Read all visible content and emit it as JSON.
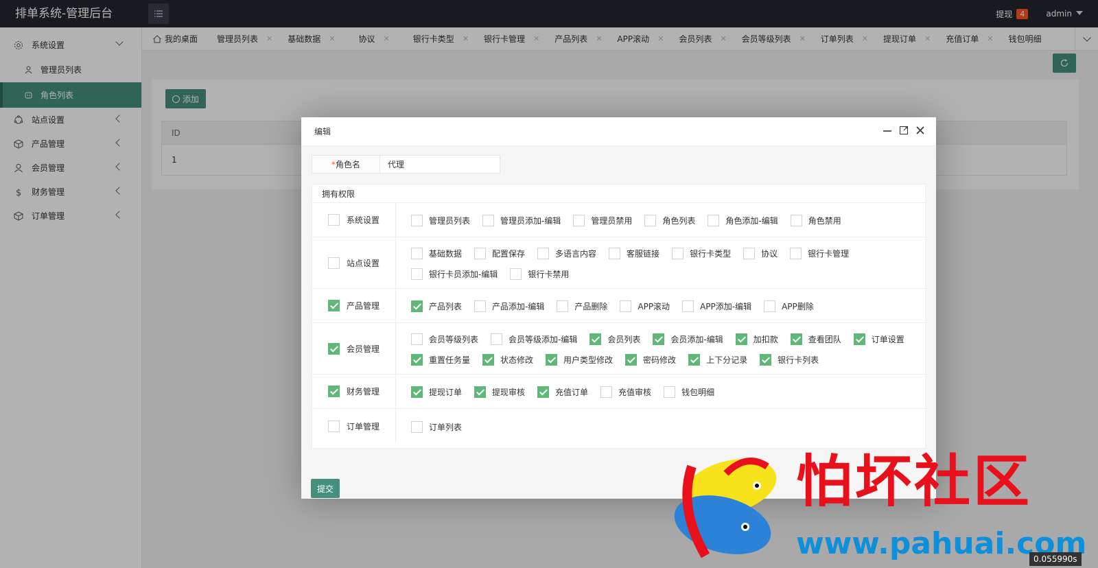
{
  "header": {
    "title": "排单系统-管理后台",
    "withdraw_label": "提现",
    "withdraw_count": "4",
    "user": "admin"
  },
  "sidebar": {
    "items": [
      {
        "label": "系统设置",
        "icon": "gear-icon",
        "expanded": true
      },
      {
        "label": "管理员列表",
        "icon": "user-icon",
        "sub": true
      },
      {
        "label": "角色列表",
        "icon": "role-icon",
        "sub": true,
        "active": true
      },
      {
        "label": "站点设置",
        "icon": "site-icon"
      },
      {
        "label": "产品管理",
        "icon": "box-icon"
      },
      {
        "label": "会员管理",
        "icon": "member-icon"
      },
      {
        "label": "财务管理",
        "icon": "dollar-icon"
      },
      {
        "label": "订单管理",
        "icon": "order-icon"
      }
    ]
  },
  "tabs": [
    "我的桌面",
    "管理员列表",
    "基础数据",
    "协议",
    "银行卡类型",
    "银行卡管理",
    "产品列表",
    "APP滚动",
    "会员列表",
    "会员等级列表",
    "订单列表",
    "提现订单",
    "充值订单",
    "钱包明细"
  ],
  "background": {
    "add_label": "添加",
    "table_header": "ID",
    "table_row": "1"
  },
  "modal": {
    "title": "编辑",
    "role_name_label": "角色名",
    "role_name_value": "代理",
    "permissions_title": "拥有权限",
    "submit_label": "提交",
    "groups": [
      {
        "name": "系统设置",
        "checked": false,
        "perms": [
          {
            "label": "管理员列表",
            "checked": false
          },
          {
            "label": "管理员添加-编辑",
            "checked": false
          },
          {
            "label": "管理员禁用",
            "checked": false
          },
          {
            "label": "角色列表",
            "checked": false
          },
          {
            "label": "角色添加-编辑",
            "checked": false
          },
          {
            "label": "角色禁用",
            "checked": false
          }
        ]
      },
      {
        "name": "站点设置",
        "checked": false,
        "perms": [
          {
            "label": "基础数据",
            "checked": false
          },
          {
            "label": "配置保存",
            "checked": false
          },
          {
            "label": "多语言内容",
            "checked": false
          },
          {
            "label": "客服链接",
            "checked": false
          },
          {
            "label": "银行卡类型",
            "checked": false
          },
          {
            "label": "协议",
            "checked": false
          },
          {
            "label": "银行卡管理",
            "checked": false
          },
          {
            "label": "银行卡员添加-编辑",
            "checked": false
          },
          {
            "label": "银行卡禁用",
            "checked": false
          }
        ]
      },
      {
        "name": "产品管理",
        "checked": true,
        "perms": [
          {
            "label": "产品列表",
            "checked": true
          },
          {
            "label": "产品添加-编辑",
            "checked": false
          },
          {
            "label": "产品删除",
            "checked": false
          },
          {
            "label": "APP滚动",
            "checked": false
          },
          {
            "label": "APP添加-编辑",
            "checked": false
          },
          {
            "label": "APP删除",
            "checked": false
          }
        ]
      },
      {
        "name": "会员管理",
        "checked": true,
        "perms": [
          {
            "label": "会员等级列表",
            "checked": false
          },
          {
            "label": "会员等级添加-编辑",
            "checked": false
          },
          {
            "label": "会员列表",
            "checked": true
          },
          {
            "label": "会员添加-编辑",
            "checked": true
          },
          {
            "label": "加扣款",
            "checked": true
          },
          {
            "label": "查看团队",
            "checked": true
          },
          {
            "label": "订单设置",
            "checked": true
          },
          {
            "label": "重置任务量",
            "checked": true
          },
          {
            "label": "状态修改",
            "checked": true
          },
          {
            "label": "用户类型修改",
            "checked": true
          },
          {
            "label": "密码修改",
            "checked": true
          },
          {
            "label": "上下分记录",
            "checked": true
          },
          {
            "label": "银行卡列表",
            "checked": true
          }
        ]
      },
      {
        "name": "财务管理",
        "checked": true,
        "perms": [
          {
            "label": "提现订单",
            "checked": true
          },
          {
            "label": "提现审核",
            "checked": true
          },
          {
            "label": "充值订单",
            "checked": true
          },
          {
            "label": "充值审核",
            "checked": false
          },
          {
            "label": "钱包明细",
            "checked": false
          }
        ]
      },
      {
        "name": "订单管理",
        "checked": false,
        "perms": [
          {
            "label": "订单列表",
            "checked": false
          }
        ]
      }
    ]
  },
  "watermark": {
    "text": "怕坏社区",
    "url": "www.pahuai.com"
  },
  "timer": "0.055990s",
  "colors": {
    "primary": "#44907d",
    "checked": "#5fb878",
    "header_bg": "#23262e",
    "badge": "#ff5722"
  }
}
